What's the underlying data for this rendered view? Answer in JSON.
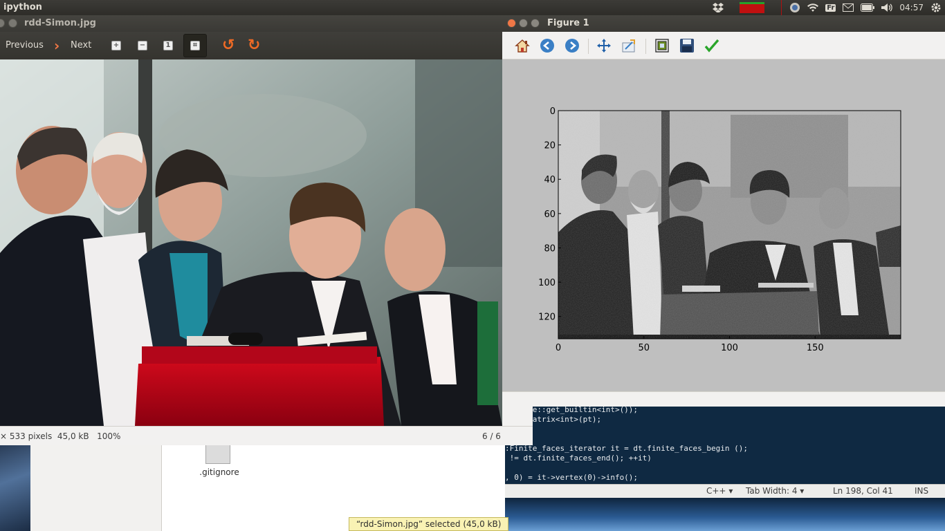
{
  "top_panel": {
    "app_title": "ipython",
    "keyboard": "Fr",
    "clock": "04:57"
  },
  "image_viewer": {
    "title": "rdd-Simon.jpg",
    "toolbar": {
      "previous": "Previous",
      "next": "Next"
    },
    "status": {
      "dimensions": "× 533 pixels",
      "size": "45,0 kB",
      "zoom": "100%",
      "position": "6 / 6"
    }
  },
  "figure": {
    "title": "Figure 1",
    "toolbar_icons": [
      "home-icon",
      "back-icon",
      "forward-icon",
      "pan-icon",
      "zoom-icon",
      "subplots-icon",
      "save-icon",
      "edit-icon"
    ]
  },
  "chart_data": {
    "type": "heatmap",
    "colormap": "gray",
    "x_ticks": [
      0,
      50,
      100,
      150
    ],
    "y_ticks": [
      0,
      20,
      40,
      60,
      80,
      100,
      120
    ],
    "xlim": [
      0,
      200
    ],
    "ylim": [
      133,
      0
    ]
  },
  "editor": {
    "lines": [
      "::dtype::get_builtin<int>());",
      "n_to_matrix<int>(pt);",
      "",
      "",
      ":Finite_faces_iterator it = dt.finite_faces_begin ();",
      " != dt.finite_faces_end(); ++it)",
      "",
      ", 0) = it->vertex(0)->info();"
    ],
    "status": {
      "language": "C++",
      "tab_width": "Tab Width: 4",
      "position": "Ln 198, Col 41",
      "mode": "INS"
    }
  },
  "file_manager": {
    "file_name": ".gitignore",
    "status": "“rdd-Simon.jpg” selected  (45,0 kB)"
  }
}
